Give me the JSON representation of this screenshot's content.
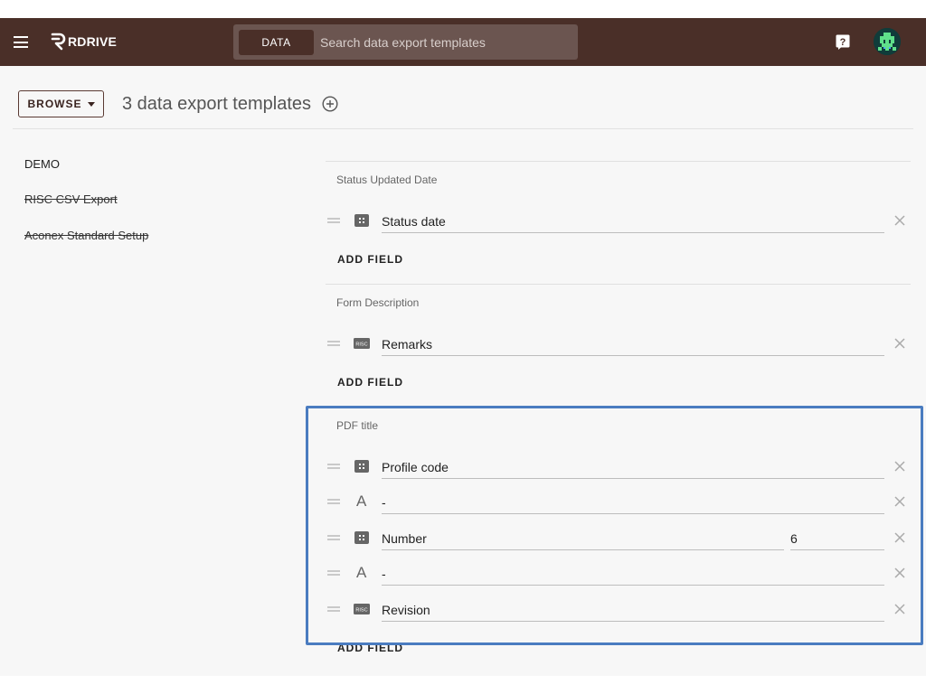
{
  "header": {
    "brand": "RDRIVE",
    "search_chip": "DATA",
    "search_placeholder": "Search data export templates"
  },
  "toolbar": {
    "browse_label": "BROWSE",
    "templates_title": "3 data export templates"
  },
  "templates": [
    {
      "label": "DEMO",
      "struck": false
    },
    {
      "label": "RISC CSV Export",
      "struck": true
    },
    {
      "label": "Aconex Standard Setup",
      "struck": true
    }
  ],
  "sections": [
    {
      "label": "Status Updated Date",
      "fields": [
        {
          "type": "grid",
          "value": "Status date"
        }
      ],
      "add_label": "ADD FIELD"
    },
    {
      "label": "Form Description",
      "fields": [
        {
          "type": "risc",
          "value": "Remarks"
        }
      ],
      "add_label": "ADD FIELD"
    },
    {
      "label": "PDF title",
      "fields": [
        {
          "type": "grid",
          "value": "Profile code"
        },
        {
          "type": "text",
          "value": "-"
        },
        {
          "type": "grid",
          "value": "Number",
          "extra": "6"
        },
        {
          "type": "text",
          "value": "-"
        },
        {
          "type": "risc",
          "value": "Revision"
        }
      ],
      "add_label": "ADD FIELD"
    }
  ],
  "icons": {
    "grid": "grid-icon",
    "risc": "risc-icon",
    "text": "text-letter-icon"
  },
  "colors": {
    "header_bg": "#4a2f28",
    "highlight": "#4a7cc0"
  }
}
